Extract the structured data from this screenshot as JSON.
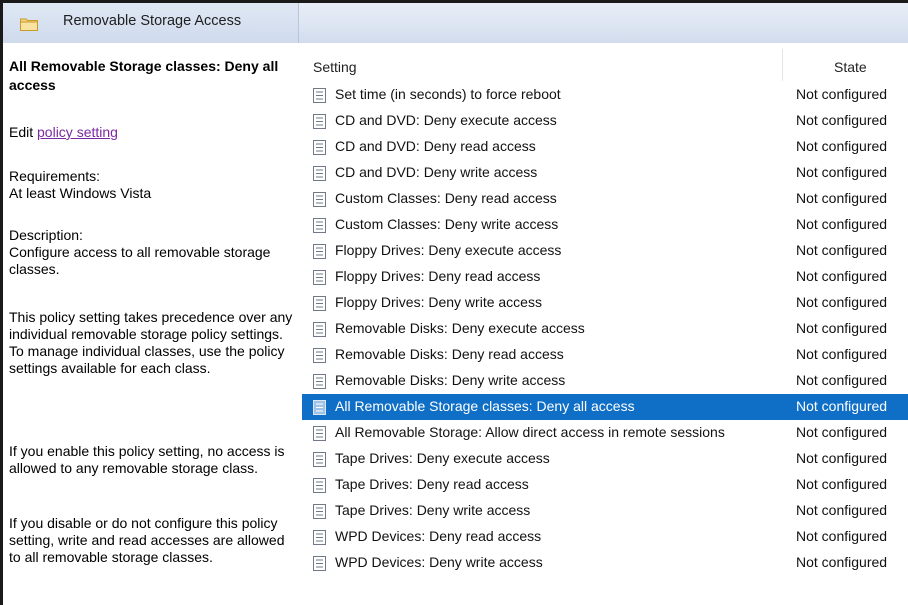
{
  "window": {
    "title": "Removable Storage Access"
  },
  "description": {
    "title": "All Removable Storage classes: Deny all access",
    "edit_prefix": "Edit ",
    "edit_link": "policy setting ",
    "requirements_label": "Requirements:",
    "requirements_value": "At least Windows Vista",
    "description_label": "Description:",
    "paragraphs": [
      "Configure access to all removable storage classes.",
      "This policy setting takes precedence over any individual removable storage policy settings. To manage individual classes, use the policy settings available for each class.",
      "If you enable this policy setting, no access is allowed to any removable storage class.",
      "If you disable or do not configure this policy setting, write and read accesses are allowed to all removable storage classes."
    ]
  },
  "list": {
    "columns": {
      "setting": "Setting",
      "state": "State"
    },
    "rows": [
      {
        "setting": "Set time (in seconds) to force reboot",
        "state": "Not configured",
        "selected": false
      },
      {
        "setting": "CD and DVD: Deny execute access",
        "state": "Not configured",
        "selected": false
      },
      {
        "setting": "CD and DVD: Deny read access",
        "state": "Not configured",
        "selected": false
      },
      {
        "setting": "CD and DVD: Deny write access",
        "state": "Not configured",
        "selected": false
      },
      {
        "setting": "Custom Classes: Deny read access",
        "state": "Not configured",
        "selected": false
      },
      {
        "setting": "Custom Classes: Deny write access",
        "state": "Not configured",
        "selected": false
      },
      {
        "setting": "Floppy Drives: Deny execute access",
        "state": "Not configured",
        "selected": false
      },
      {
        "setting": "Floppy Drives: Deny read access",
        "state": "Not configured",
        "selected": false
      },
      {
        "setting": "Floppy Drives: Deny write access",
        "state": "Not configured",
        "selected": false
      },
      {
        "setting": "Removable Disks: Deny execute access",
        "state": "Not configured",
        "selected": false
      },
      {
        "setting": "Removable Disks: Deny read access",
        "state": "Not configured",
        "selected": false
      },
      {
        "setting": "Removable Disks: Deny write access",
        "state": "Not configured",
        "selected": false
      },
      {
        "setting": "All Removable Storage classes: Deny all access",
        "state": "Not configured",
        "selected": true
      },
      {
        "setting": "All Removable Storage: Allow direct access in remote sessions",
        "state": "Not configured",
        "selected": false
      },
      {
        "setting": "Tape Drives: Deny execute access",
        "state": "Not configured",
        "selected": false
      },
      {
        "setting": "Tape Drives: Deny read access",
        "state": "Not configured",
        "selected": false
      },
      {
        "setting": "Tape Drives: Deny write access",
        "state": "Not configured",
        "selected": false
      },
      {
        "setting": "WPD Devices: Deny read access",
        "state": "Not configured",
        "selected": false
      },
      {
        "setting": "WPD Devices: Deny write access",
        "state": "Not configured",
        "selected": false
      }
    ]
  },
  "icons": {
    "title_icon": "folder-icon",
    "row_icon": "policy-setting-icon"
  },
  "colors": {
    "selection": "#0f6fc6",
    "link": "#7a2aa0",
    "titlebar": "#dbe4f1"
  }
}
